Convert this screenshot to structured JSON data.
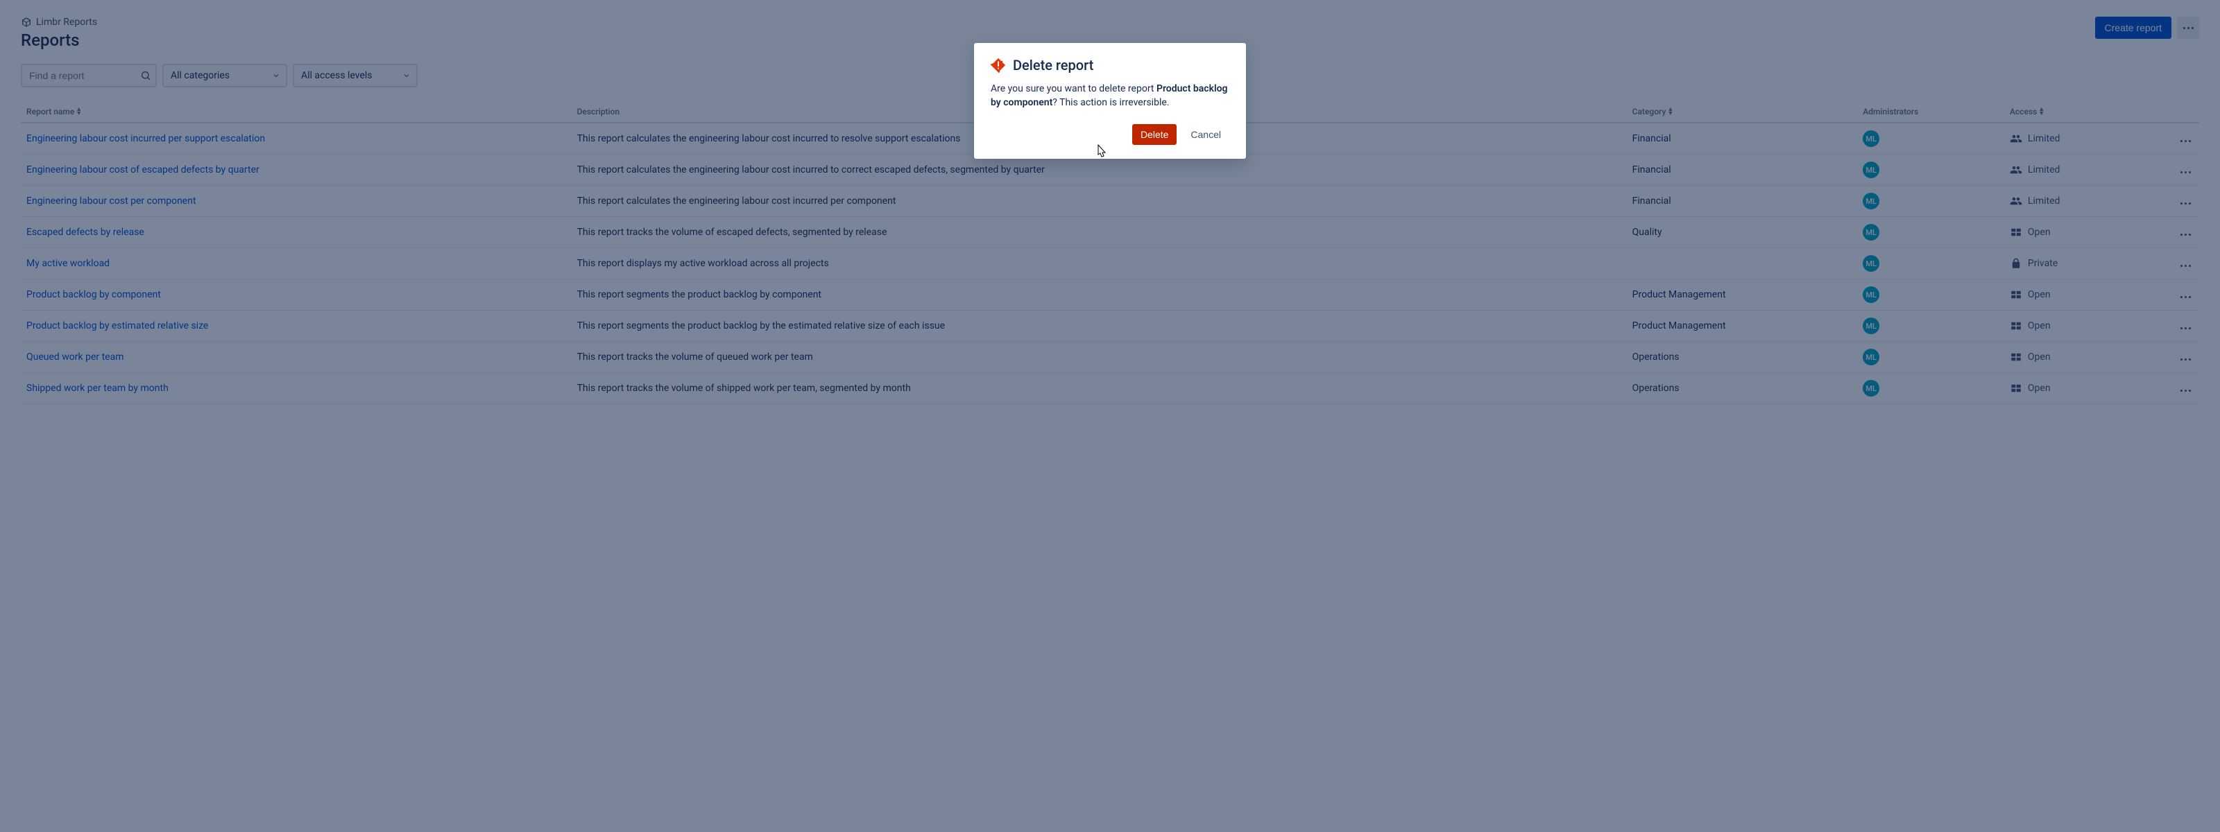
{
  "breadcrumb": {
    "app": "Limbr Reports"
  },
  "page": {
    "title": "Reports"
  },
  "actions": {
    "create": "Create report"
  },
  "filters": {
    "search_placeholder": "Find a report",
    "category": "All categories",
    "access": "All access levels"
  },
  "columns": {
    "name": "Report name",
    "description": "Description",
    "category": "Category",
    "administrators": "Administrators",
    "access": "Access"
  },
  "admin_initials": "ML",
  "access_labels": {
    "limited": "Limited",
    "open": "Open",
    "private": "Private"
  },
  "rows": [
    {
      "name": "Engineering labour cost incurred per support escalation",
      "description": "This report calculates the engineering labour cost incurred to resolve support escalations",
      "category": "Financial",
      "access": "limited"
    },
    {
      "name": "Engineering labour cost of escaped defects by quarter",
      "description": "This report calculates the engineering labour cost incurred to correct escaped defects, segmented by quarter",
      "category": "Financial",
      "access": "limited"
    },
    {
      "name": "Engineering labour cost per component",
      "description": "This report calculates the engineering labour cost incurred per component",
      "category": "Financial",
      "access": "limited"
    },
    {
      "name": "Escaped defects by release",
      "description": "This report tracks the volume of escaped defects, segmented by release",
      "category": "Quality",
      "access": "open"
    },
    {
      "name": "My active workload",
      "description": "This report displays my active workload across all projects",
      "category": "",
      "access": "private"
    },
    {
      "name": "Product backlog by component",
      "description": "This report segments the product backlog by component",
      "category": "Product Management",
      "access": "open"
    },
    {
      "name": "Product backlog by estimated relative size",
      "description": "This report segments the product backlog by the estimated relative size of each issue",
      "category": "Product Management",
      "access": "open"
    },
    {
      "name": "Queued work per team",
      "description": "This report tracks the volume of queued work per team",
      "category": "Operations",
      "access": "open"
    },
    {
      "name": "Shipped work per team by month",
      "description": "This report tracks the volume of shipped work per team, segmented by month",
      "category": "Operations",
      "access": "open"
    }
  ],
  "modal": {
    "title": "Delete report",
    "body_prefix": "Are you sure you want to delete report ",
    "target": "Product backlog by component",
    "body_suffix": "? This action is irreversible.",
    "delete": "Delete",
    "cancel": "Cancel"
  }
}
